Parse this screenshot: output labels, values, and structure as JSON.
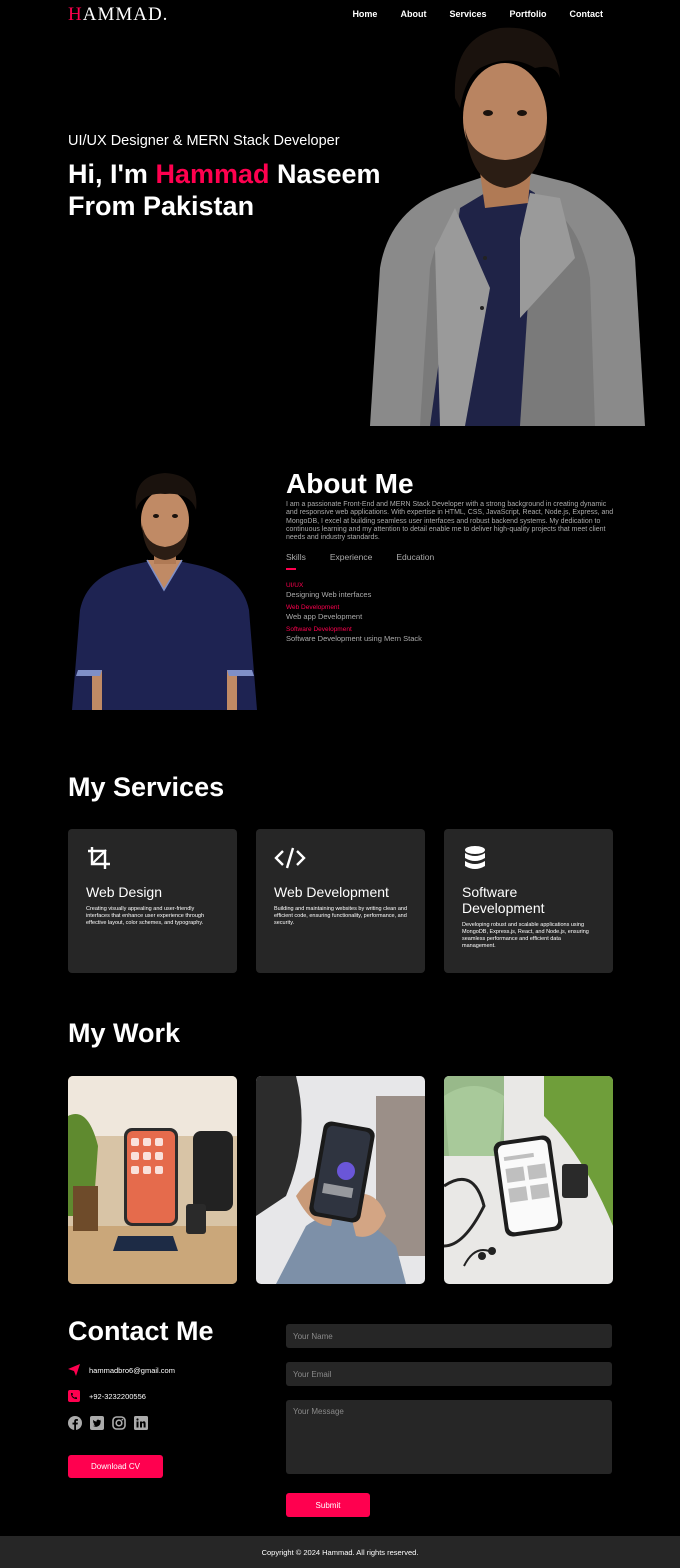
{
  "header": {
    "logo_h": "H",
    "logo_rest": "AMMAD.",
    "nav": [
      "Home",
      "About",
      "Services",
      "Portfolio",
      "Contact"
    ]
  },
  "hero": {
    "subtitle": "UI/UX Designer & MERN Stack Developer",
    "title_pre": "Hi, I'm ",
    "title_name": "Hammad",
    "title_post": " Naseem From Pakistan"
  },
  "about": {
    "title": "About Me",
    "text": "I am a passionate Front-End and MERN Stack Developer with a strong background in creating dynamic and responsive web applications. With expertise in HTML, CSS, JavaScript, React, Node.js, Express, and MongoDB, I excel at building seamless user interfaces and robust backend systems. My dedication to continuous learning and my attention to detail enable me to deliver high-quality projects that meet client needs and industry standards.",
    "tabs": [
      "Skills",
      "Experience",
      "Education"
    ],
    "skills": [
      {
        "key": "UI/UX",
        "value": "Designing Web interfaces"
      },
      {
        "key": "Web Development",
        "value": "Web app Development"
      },
      {
        "key": "Software Development",
        "value": "Software Development using Mern Stack"
      }
    ]
  },
  "services": {
    "title": "My Services",
    "items": [
      {
        "icon": "crop-icon",
        "title": "Web Design",
        "text": "Creating visually appealing and user-friendly interfaces that enhance user experience through effective layout, color schemes, and typography."
      },
      {
        "icon": "code-icon",
        "title": "Web Development",
        "text": "Building and maintaining websites by writing clean and efficient code, ensuring functionality, performance, and security."
      },
      {
        "icon": "database-icon",
        "title": "Software Development",
        "text": "Developing robust and scalable applications using MongoDB, Express.js, React, and Node.js, ensuring seamless performance and efficient data management."
      }
    ]
  },
  "work": {
    "title": "My Work"
  },
  "contact": {
    "title": "Contact Me",
    "email": "hammadbro6@gmail.com",
    "phone": "+92-3232200556",
    "download_cv": "Download CV",
    "name_placeholder": "Your Name",
    "email_placeholder": "Your Email",
    "message_placeholder": "Your Message",
    "submit": "Submit"
  },
  "footer": {
    "text": "Copyright © 2024 Hammad. All rights reserved."
  },
  "colors": {
    "accent": "#ff004f",
    "background": "#000000",
    "card": "#262626",
    "muted_text": "#ababab"
  }
}
